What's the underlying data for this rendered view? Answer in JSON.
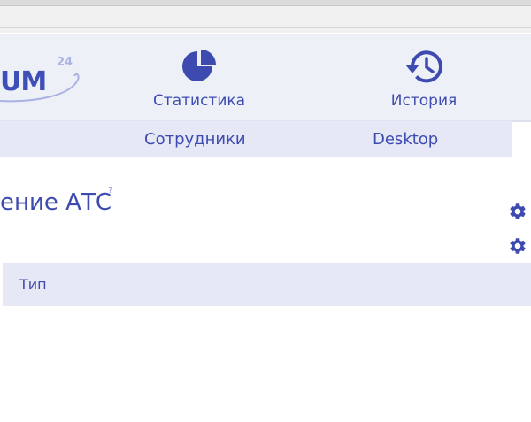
{
  "logo": {
    "text": "UM",
    "superscript": "24"
  },
  "nav": {
    "statistics": {
      "label": "Статистика",
      "icon": "pie-chart-icon"
    },
    "history": {
      "label": "История",
      "icon": "history-icon"
    }
  },
  "subnav": {
    "items": [
      {
        "label": "Сотрудники"
      },
      {
        "label": "Desktop"
      }
    ]
  },
  "page": {
    "title": "ение АТС",
    "help_mark": "?"
  },
  "settings": [
    {
      "icon": "gear-icon"
    },
    {
      "icon": "gear-icon"
    }
  ],
  "table": {
    "columns": [
      "Тип"
    ]
  },
  "colors": {
    "accent": "#3d4bb0",
    "nav_background": "#eef0f8",
    "subnav_background": "#e6e8f5"
  }
}
